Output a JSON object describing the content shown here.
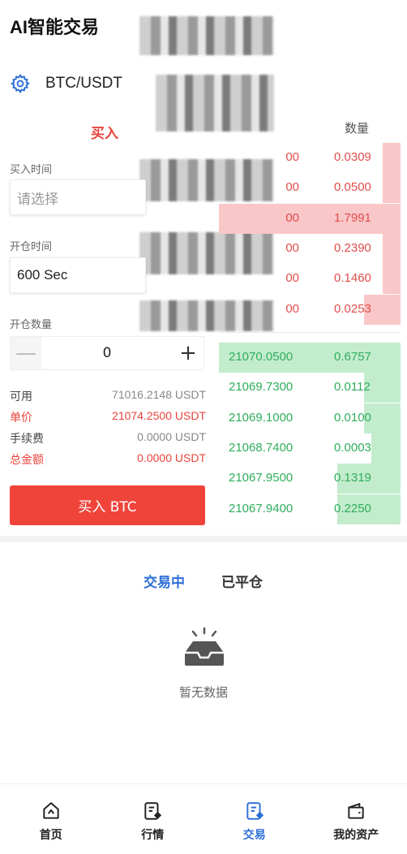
{
  "header": {
    "title": "AI智能交易"
  },
  "pair": {
    "label": "BTC/USDT",
    "icon": "gear-icon"
  },
  "tabs": {
    "buy": "买入"
  },
  "orderbook_header": {
    "qty": "数量"
  },
  "form": {
    "buy_time_label": "买入时间",
    "buy_time_placeholder": "请选择",
    "open_time_label": "开仓时间",
    "open_time_value": "600 Sec",
    "open_qty_label": "开仓数量",
    "qty_value": "0",
    "minus": "—",
    "plus": "+"
  },
  "info": {
    "available_label": "可用",
    "available_value": "71016.2148  USDT",
    "price_label": "单价",
    "price_value": "21074.2500  USDT",
    "fee_label": "手续费",
    "fee_value": "0.0000  USDT",
    "total_label": "总金额",
    "total_value": "0.0000  USDT"
  },
  "buy_button": {
    "label": "买入 BTC"
  },
  "asks": [
    {
      "price": "00",
      "amount": "0.0309",
      "depth": 0.1
    },
    {
      "price": "00",
      "amount": "0.0500",
      "depth": 0.1
    },
    {
      "price": "00",
      "amount": "1.7991",
      "depth": 1.0
    },
    {
      "price": "00",
      "amount": "0.2390",
      "depth": 0.1
    },
    {
      "price": "00",
      "amount": "0.1460",
      "depth": 0.1
    },
    {
      "price": "00",
      "amount": "0.0253",
      "depth": 0.2
    }
  ],
  "bids": [
    {
      "price": "21070.0500",
      "amount": "0.6757",
      "depth": 1.0
    },
    {
      "price": "21069.7300",
      "amount": "0.0112",
      "depth": 0.2
    },
    {
      "price": "21069.1000",
      "amount": "0.0100",
      "depth": 0.2
    },
    {
      "price": "21068.7400",
      "amount": "0.0003",
      "depth": 0.16
    },
    {
      "price": "21067.9500",
      "amount": "0.1319",
      "depth": 0.35
    },
    {
      "price": "21067.9400",
      "amount": "0.2250",
      "depth": 0.35
    }
  ],
  "order_tabs": {
    "active": "交易中",
    "closed": "已平仓"
  },
  "empty": {
    "text": "暂无数据"
  },
  "nav": {
    "home": "首页",
    "market": "行情",
    "trade": "交易",
    "assets": "我的资产"
  },
  "colors": {
    "red": "#e8443b",
    "green": "#2fae5c",
    "blue": "#2d6fd8"
  }
}
